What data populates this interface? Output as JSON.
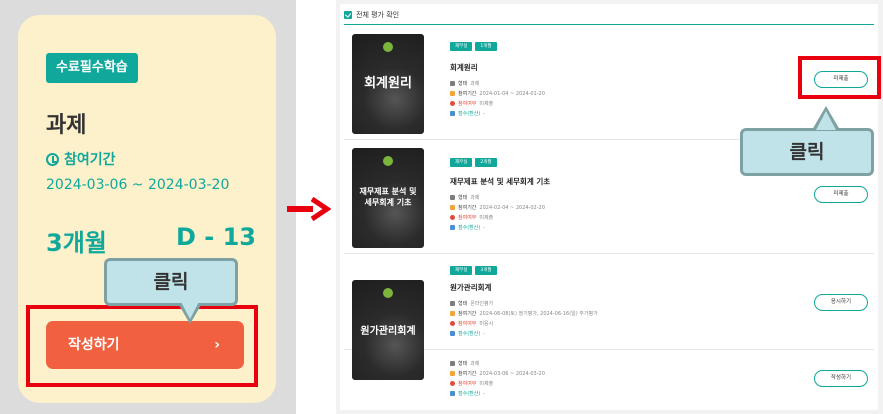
{
  "left_card": {
    "badge": "수료필수학습",
    "title": "과제",
    "period_label": "참여기간",
    "period_dates": "2024-03-06 ~ 2024-03-20",
    "months": "3개월",
    "dday": "D - 13",
    "write_button": "작성하기",
    "chevron": "›",
    "callout": "클릭"
  },
  "right_panel": {
    "section_title": "전체 평가 확인",
    "callout": "클릭",
    "rows": [
      {
        "thumb_title": "회계원리",
        "tags": [
          "재무실",
          "1개월"
        ],
        "title": "회계원리",
        "meta": [
          {
            "k": "형태",
            "v": "과제"
          },
          {
            "k": "참여기간",
            "v": "2024-01-04 ~ 2024-01-20"
          },
          {
            "k": "참여여부",
            "v": "미제출"
          },
          {
            "k": "점수(환산)",
            "v": "-"
          }
        ],
        "button": "미제출"
      },
      {
        "thumb_title": "재무제표 분석 및 세무회계 기초",
        "tags": [
          "재무실",
          "2개월"
        ],
        "title": "재무제표 분석 및 세무회계 기초",
        "meta": [
          {
            "k": "형태",
            "v": "과제"
          },
          {
            "k": "참여기간",
            "v": "2024-02-04 ~ 2024-02-20"
          },
          {
            "k": "참여여부",
            "v": "미제출"
          },
          {
            "k": "점수(환산)",
            "v": "-"
          }
        ],
        "button": "미제출"
      },
      {
        "thumb_title": "원가관리회계",
        "tags": [
          "재무실",
          "3개월"
        ],
        "title": "원가관리회계",
        "meta": [
          {
            "k": "형태",
            "v": "온라인평가"
          },
          {
            "k": "참여기간",
            "v": "2024-06-08(토) 정기평가, 2024-06-16(일) 추가평가"
          },
          {
            "k": "참여여부",
            "v": "미응시"
          },
          {
            "k": "점수(환산)",
            "v": "-"
          }
        ],
        "button": "응시하기"
      },
      {
        "meta": [
          {
            "k": "형태",
            "v": "과제"
          },
          {
            "k": "참여기간",
            "v": "2024-03-06 ~ 2024-03-20"
          },
          {
            "k": "참여여부",
            "v": "미제출"
          },
          {
            "k": "점수(환산)",
            "v": "-"
          }
        ],
        "button": "작성하기"
      }
    ]
  },
  "colors": {
    "teal": "#0fa89b",
    "card_bg": "#fdf1cc",
    "cta": "#f16140",
    "highlight_red": "#e8000f",
    "callout_bg": "#bfe3e8"
  }
}
